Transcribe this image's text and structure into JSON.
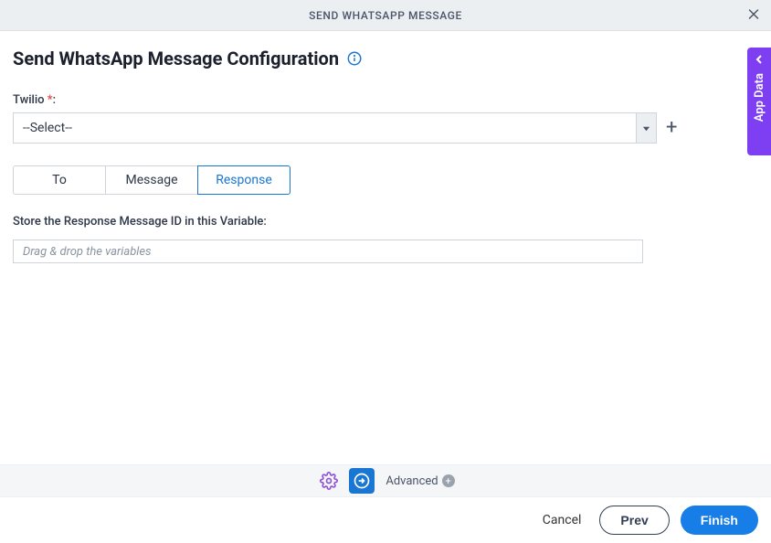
{
  "title_bar": {
    "title": "SEND WHATSAPP MESSAGE"
  },
  "heading": "Send WhatsApp Message Configuration",
  "twilio_field": {
    "label": "Twilio",
    "required_marker": "*",
    "colon": ":",
    "selected_value": "--Select--"
  },
  "tabs": {
    "to": "To",
    "message": "Message",
    "response": "Response"
  },
  "response_tab": {
    "variable_label": "Store the Response Message ID in this Variable:",
    "placeholder": "Drag & drop the variables"
  },
  "footer": {
    "advanced_label": "Advanced"
  },
  "actions": {
    "cancel": "Cancel",
    "prev": "Prev",
    "finish": "Finish"
  },
  "side_tab": {
    "label": "App Data"
  }
}
